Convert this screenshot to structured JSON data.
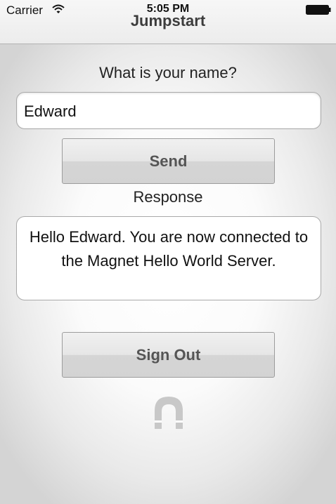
{
  "status_bar": {
    "carrier": "Carrier",
    "time": "5:05 PM"
  },
  "nav": {
    "title": "Jumpstart"
  },
  "form": {
    "question": "What is your name?",
    "name_value": "Edward",
    "send_label": "Send",
    "response_label": "Response",
    "response_text": "Hello Edward. You are now connected to the Magnet Hello World Server.",
    "sign_out_label": "Sign Out"
  },
  "icons": {
    "wifi": "wifi-icon",
    "battery": "battery-icon",
    "logo": "magnet-logo-icon"
  },
  "colors": {
    "button_text": "#555555",
    "logo": "#c8c8c8"
  }
}
